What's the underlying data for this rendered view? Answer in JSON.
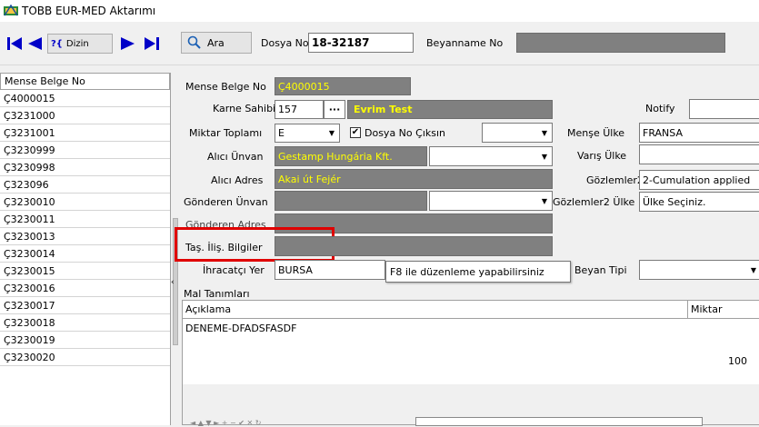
{
  "window": {
    "title": "TOBB EUR-MED Aktarımı"
  },
  "toolbar": {
    "dizin_label": "Dizin",
    "help_label": "?{",
    "search_label": "Ara",
    "dosya_no_label": "Dosya No",
    "dosya_no_value": "18-32187",
    "beyanname_no_label": "Beyanname No",
    "beyanname_no_value": ""
  },
  "left_list": {
    "header": "Mense Belge No",
    "items": [
      "Ç4000015",
      "Ç3231000",
      "Ç3231001",
      "Ç3230999",
      "Ç3230998",
      "Ç323096",
      "Ç3230010",
      "Ç3230011",
      "Ç3230013",
      "Ç3230014",
      "Ç3230015",
      "Ç3230016",
      "Ç3230017",
      "Ç3230018",
      "Ç3230019",
      "Ç3230020"
    ]
  },
  "form": {
    "mense_belge_no_label": "Mense Belge No",
    "mense_belge_no_value": "Ç4000015",
    "karne_sahibi_label": "Karne Sahibi",
    "karne_sahibi_code": "157",
    "karne_sahibi_ellipsis": "···",
    "karne_sahibi_name": "Evrim Test",
    "notify_label": "Notify",
    "notify_value": "",
    "miktar_toplami_label": "Miktar Toplamı",
    "miktar_toplami_value": "E",
    "dosya_no_ciksin_label": "Dosya No Çıksın",
    "dosya_no_ciksin_checked": true,
    "menshe_ulke_label": "Menşe Ülke",
    "menshe_ulke_value": "FRANSA",
    "alici_unvan_label": "Alıcı Ünvan",
    "alici_unvan_value": "Gestamp Hungária Kft.",
    "varis_ulke_label": "Varış Ülke",
    "varis_ulke_value": "",
    "alici_adres_label": "Alıcı Adres",
    "alici_adres_value": "Akai út  Fejér",
    "gozlemler2_label": "Gözlemler2",
    "gozlemler2_value": "2-Cumulation applied",
    "gonderen_unvan_label": "Gönderen Ünvan",
    "gozlemler2_ulke_label": "Gözlemler2 Ülke",
    "gozlemler2_ulke_value": "Ülke Seçiniz.",
    "gonderen_adres_label": "Gönderen Adres",
    "tas_ilis_label": "Taş. İliş. Bilgiler",
    "ihracatci_yer_label": "İhracatçı Yer",
    "ihracatci_yer_value": "BURSA",
    "beyan_tipi_label": "Beyan Tipi",
    "tooltip": "F8 ile düzenleme yapabilirsiniz"
  },
  "goods": {
    "section_label": "Mal Tanımları",
    "col_aciklama": "Açıklama",
    "col_miktar": "Miktar",
    "row_description": "DENEME-DFADSFASDF",
    "row_miktar": "100"
  },
  "colors": {
    "highlight": "#e00000",
    "gray_field": "#808080",
    "yellow_text": "#ffff00",
    "nav_blue": "#0000c8"
  }
}
